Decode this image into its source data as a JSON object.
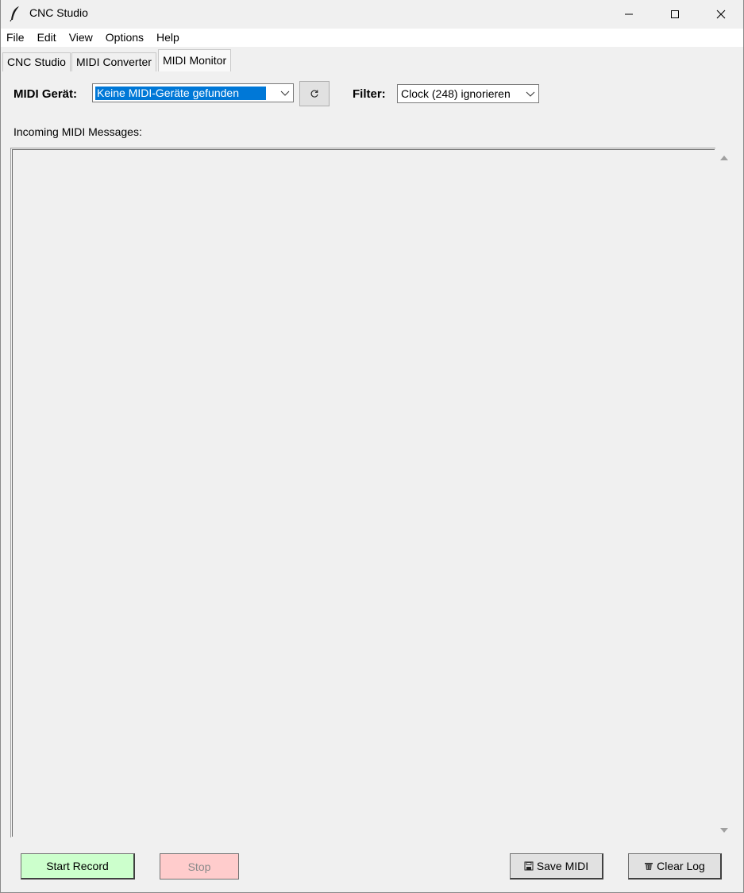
{
  "window": {
    "title": "CNC Studio",
    "controls": {
      "minimize_icon": "minimize-icon",
      "maximize_icon": "maximize-icon",
      "close_icon": "close-icon"
    }
  },
  "menu": {
    "items": [
      {
        "label": "File"
      },
      {
        "label": "Edit"
      },
      {
        "label": "View"
      },
      {
        "label": "Options"
      },
      {
        "label": "Help"
      }
    ]
  },
  "tabs": [
    {
      "label": "CNC Studio",
      "active": false
    },
    {
      "label": "MIDI Converter",
      "active": false
    },
    {
      "label": "MIDI Monitor",
      "active": true
    }
  ],
  "toolbar": {
    "device_label": "MIDI Gerät:",
    "device_value": "Keine MIDI-Geräte gefunden",
    "refresh_icon": "refresh-icon",
    "filter_label": "Filter:",
    "filter_value": "Clock (248) ignorieren"
  },
  "monitor": {
    "label": "Incoming MIDI Messages:",
    "messages": []
  },
  "buttons": {
    "start_record": "Start Record",
    "stop": "Stop",
    "save_midi": "Save MIDI",
    "save_icon": "save-icon",
    "clear_log": "Clear Log",
    "clear_icon": "trash-icon"
  },
  "colors": {
    "start_bg": "#ccffcc",
    "stop_bg": "#ffcccc",
    "selection": "#0078d7"
  }
}
